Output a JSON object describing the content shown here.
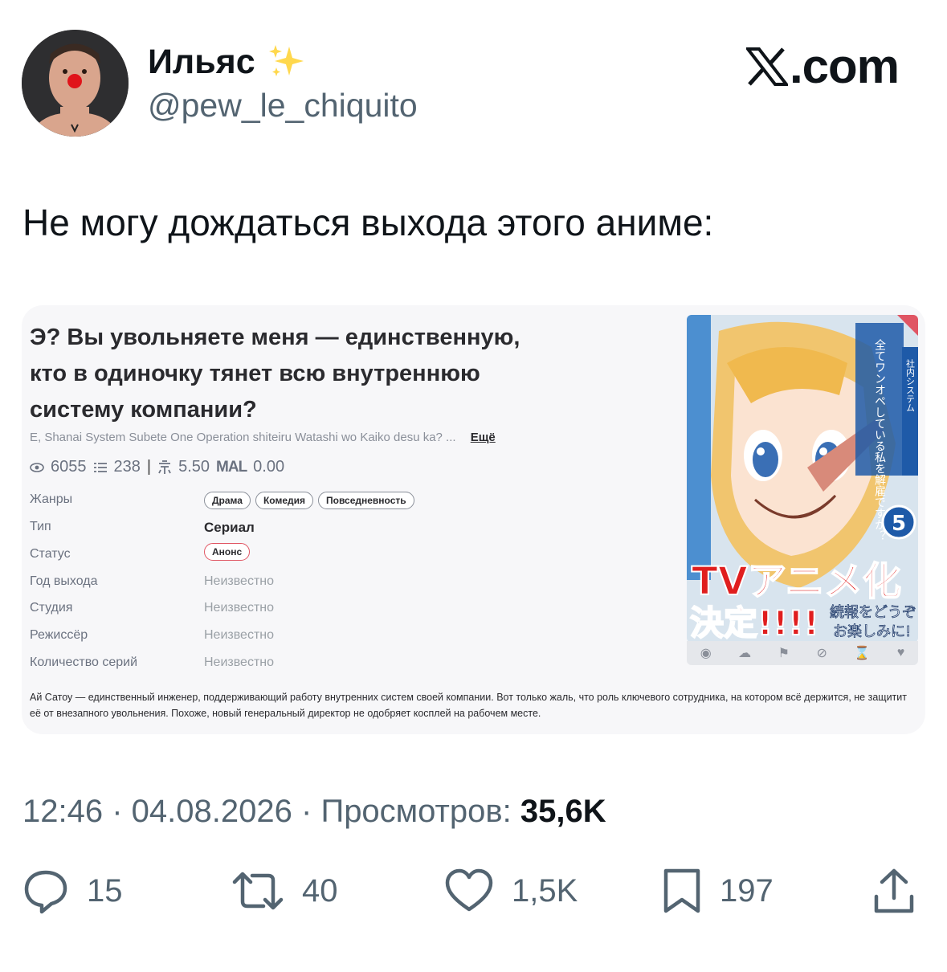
{
  "author": {
    "name": "Ильяс",
    "handle": "@pew_le_chiquito",
    "badge_icon": "sparkles-icon"
  },
  "brand": {
    "label": ".com"
  },
  "tweet": {
    "text": "Не могу дождаться выхода этого аниме:"
  },
  "card": {
    "title": "Э? Вы увольняете меня — единственную, кто в одиночку тянет всю внутреннюю систему компании?",
    "alt_title": "E, Shanai System Subete One Operation shiteiru Watashi wo Kaiko desu ka? ...",
    "more_label": "Ещё",
    "stats": {
      "views": "6055",
      "chapters": "238",
      "score": "5.50",
      "mal_label": "MAL",
      "mal_score": "0.00"
    },
    "rows": [
      {
        "label": "Жанры"
      },
      {
        "label": "Тип",
        "value": "Сериал"
      },
      {
        "label": "Статус"
      },
      {
        "label": "Год выхода",
        "value": "Неизвестно"
      },
      {
        "label": "Студия",
        "value": "Неизвестно"
      },
      {
        "label": "Режиссёр",
        "value": "Неизвестно"
      },
      {
        "label": "Количество серий",
        "value": "Неизвестно"
      }
    ],
    "genres": [
      "Драма",
      "Комедия",
      "Повседневность"
    ],
    "status": "Анонс",
    "description": "Ай Сатоу — единственный инженер, поддерживающий работу внутренних систем своей компании. Вот только жаль, что роль ключевого сотрудника, на котором всё держится, не защитит её от внезапного увольнения. Похоже, новый генеральный директор не одобряет косплей на рабочем месте.",
    "cover": {
      "vertical_title": "全てワンオペしている私を解雇ですか？",
      "side_title": "社内システム",
      "volume": "5",
      "banner_top": "TVアニメ化",
      "banner_bottom": "決定!!!!",
      "banner_note_1": "続報をどうぞ",
      "banner_note_2": "お楽しみに!"
    }
  },
  "meta": {
    "time": "12:46",
    "date": "04.08.2026",
    "views_label": "Просмотров:",
    "views": "35,6K"
  },
  "actions": {
    "replies": "15",
    "reposts": "40",
    "likes": "1,5K",
    "bookmarks": "197"
  },
  "colors": {
    "text": "#0f1419",
    "secondary": "#536471",
    "card_bg": "#f7f7f9",
    "status_red": "#e05563"
  }
}
